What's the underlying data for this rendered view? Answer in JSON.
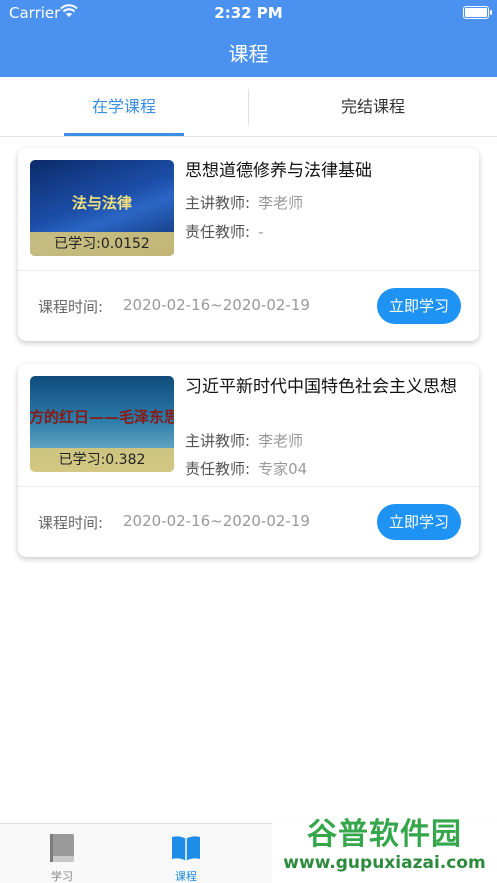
{
  "status_bar": {
    "carrier": "Carrier",
    "time": "2:32 PM"
  },
  "nav": {
    "title": "课程"
  },
  "tabs": [
    {
      "label": "在学课程",
      "active": true
    },
    {
      "label": "完结课程",
      "active": false
    }
  ],
  "courses": [
    {
      "thumb_text": "法与法律",
      "progress": "已学习:0.0152",
      "title": "思想道德修养与法律基础",
      "teacher_label": "主讲教师:",
      "teacher": "李老师",
      "owner_label": "责任教师:",
      "owner": "-",
      "time_label": "课程时间:",
      "time": "2020-02-16~2020-02-19",
      "button": "立即学习"
    },
    {
      "thumb_text": "方的红日——毛泽东思",
      "progress": "已学习:0.382",
      "title": "习近平新时代中国特色社会主义思想",
      "teacher_label": "主讲教师:",
      "teacher": "李老师",
      "owner_label": "责任教师:",
      "owner": "专家04",
      "time_label": "课程时间:",
      "time": "2020-02-16~2020-02-19",
      "button": "立即学习"
    }
  ],
  "tabbar": [
    {
      "label": "学习",
      "icon": "book-closed-icon",
      "active": false
    },
    {
      "label": "课程",
      "icon": "book-open-icon",
      "active": true
    }
  ],
  "watermark": {
    "name": "谷普软件园",
    "url": "www.gupuxiazai.com"
  },
  "colors": {
    "primary": "#4b92f0",
    "button": "#1e93f3",
    "tab_active": "#3a8ee6"
  }
}
